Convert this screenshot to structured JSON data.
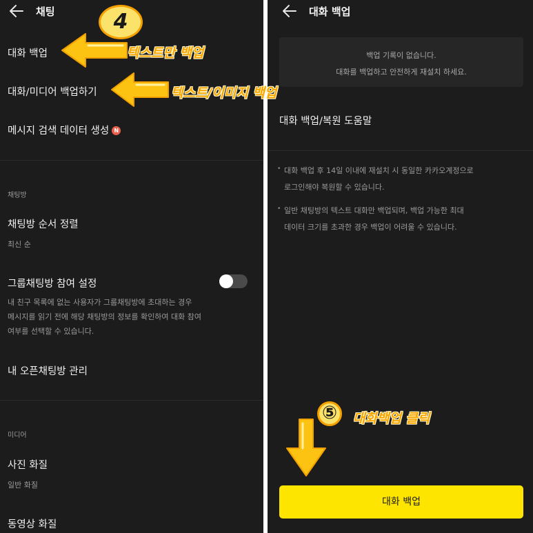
{
  "left_panel": {
    "title": "채팅",
    "items": {
      "chat_backup": "대화 백업",
      "media_backup": "대화/미디어 백업하기",
      "search_data": "메시지 검색 데이터 생성",
      "new_badge": "N"
    },
    "section_chatroom": "채팅방",
    "sort": {
      "title": "채팅방 순서 정렬",
      "value": "최신 순"
    },
    "group_join": {
      "title": "그룹채팅방 참여 설정",
      "enabled": false,
      "desc": [
        "내 친구 목록에 없는 사용자가 그룹채팅방에 초대하는 경우",
        "메시지를 읽기 전에 해당 채팅방의 정보를 확인하여 대화 참여",
        "여부를 선택할 수 있습니다."
      ]
    },
    "open_chat": "내 오픈채팅방 관리",
    "section_media": "미디어",
    "photo": {
      "title": "사진 화질",
      "value": "일반 화질"
    },
    "video": {
      "title": "동영상 화질"
    }
  },
  "right_panel": {
    "title": "대화 백업",
    "notice": [
      "백업 기록이 없습니다.",
      "대화를 백업하고 안전하게 재설치 하세요."
    ],
    "help": "대화 백업/복원 도움말",
    "notes": [
      [
        "대화 백업 후 14일 이내에 재설치 시 동일한 카카오계정으로",
        "로그인해야 복원할 수 있습니다."
      ],
      [
        "일반 채팅방의 텍스트 대화만 백업되며, 백업 가능한 최대",
        "데이터 크기를 초과한 경우 백업이 어려울 수 있습니다."
      ]
    ],
    "bullet": "•",
    "button_label": "대화 백업"
  },
  "annotations": {
    "step4_num": "4",
    "step4_label_text": "텍스트만 백업",
    "step4_label_media": "텍스트/이미지 백업",
    "step5_num": "⑤",
    "step5_label": "대화백업 클릭"
  },
  "colors": {
    "background": "#1c1c1c",
    "accent_yellow": "#fee500",
    "annotation_orange": "#f7a500",
    "badge_red": "#e8604c"
  }
}
